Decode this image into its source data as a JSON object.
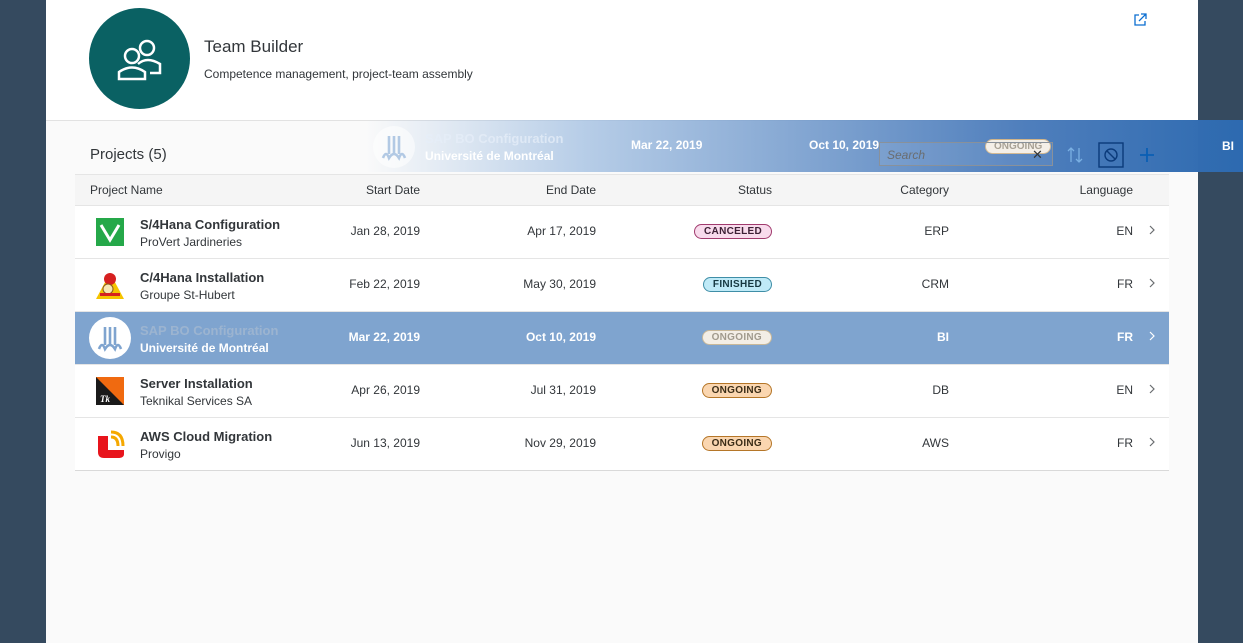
{
  "header": {
    "title": "Team Builder",
    "subtitle": "Competence management, project-team assembly",
    "avatar_icon": "team-icon",
    "share_icon": "share-icon"
  },
  "table": {
    "title": "Projects (5)",
    "search_placeholder": "Search",
    "columns": [
      "Project Name",
      "Start Date",
      "End Date",
      "Status",
      "Category",
      "Language"
    ],
    "rows": [
      {
        "name": "S/4Hana Configuration",
        "customer": "ProVert Jardineries",
        "start": "Jan 28, 2019",
        "end": "Apr 17, 2019",
        "status": "CANCELED",
        "category": "ERP",
        "language": "EN"
      },
      {
        "name": "C/4Hana Installation",
        "customer": "Groupe St-Hubert",
        "start": "Feb 22, 2019",
        "end": "May 30, 2019",
        "status": "FINISHED",
        "category": "CRM",
        "language": "FR"
      },
      {
        "name": "SAP BO Configuration",
        "customer": "Université de Montréal",
        "start": "Mar 22, 2019",
        "end": "Oct 10, 2019",
        "status": "ONGOING",
        "category": "BI",
        "language": "FR"
      },
      {
        "name": "Server Installation",
        "customer": "Teknikal Services SA",
        "start": "Apr 26, 2019",
        "end": "Jul 31, 2019",
        "status": "ONGOING",
        "category": "DB",
        "language": "EN"
      },
      {
        "name": "AWS Cloud Migration",
        "customer": "Provigo",
        "start": "Jun 13, 2019",
        "end": "Nov 29, 2019",
        "status": "ONGOING",
        "category": "AWS",
        "language": "FR"
      }
    ]
  },
  "drag_ghost": {
    "name": "SAP BO Configuration",
    "customer": "Université de Montréal",
    "start": "Mar 22, 2019",
    "end": "Oct 10, 2019",
    "status": "ONGOING",
    "category": "BI"
  },
  "colors": {
    "shell": "#354a5f",
    "avatar": "#0a6163",
    "selected_row": "#7fa4cf",
    "accent": "#0a6ed1"
  }
}
